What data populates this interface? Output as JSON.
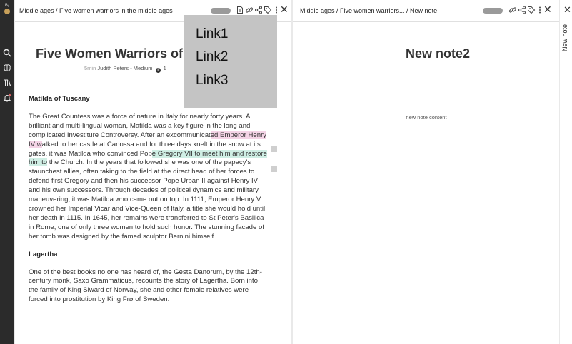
{
  "rail": {
    "brand_text": "B/",
    "icons": [
      "search-icon",
      "brain-icon",
      "library-icon",
      "bell-icon"
    ]
  },
  "pane_left": {
    "breadcrumb": "Middle ages / Five women warriors in the middle ages",
    "title": "Five Women Warriors of th",
    "meta": {
      "read_time": "5min",
      "author": "Judith Peters - Medium",
      "info_glyph": "i",
      "count": "1"
    },
    "sections": [
      {
        "heading": "Matilda of Tuscany",
        "paragraph": {
          "before_pink": "The Great Countess was a force of nature in Italy for nearly forty years. A brilliant and multi-lingual woman, Matilda was a key figure in the long and complicated Investiture Controversy. After an excommunicat",
          "pink": "ed Emperor Henry IV w",
          "between": "alked to her castle at Canossa and for three days knelt in the snow at its gates, it was Matilda who convinced Pop",
          "green": "e Gregory VII to meet him and restore him to",
          "after": " the Church. In the years that followed she was one of the papacy's staunchest allies, often taking to the field at the direct head of her forces to defend first Gregory and then his successor Pope Urban II against Henry IV and his own successors. Through decades of political dynamics and military maneuvering, it was Matilda who came out on top. In 1111, Emperor Henry V crowned her Imperial Vicar and Vice-Queen of Italy, a title she would hold until her death in 1115. In 1645, her remains were transferred to St Peter's Basilica in Rome, one of only three women to hold such honor. The stunning facade of her tomb was designed by the famed sculptor Bernini himself."
        }
      },
      {
        "heading": "Lagertha",
        "paragraph": "One of the best books no one has heard of, the Gesta Danorum, by the 12th-century monk, Saxo Grammaticus, recounts the story of Lagertha. Born into the family of King Siward of Norway, she and other female relatives were forced into prostitution by King Frø of Sweden."
      }
    ]
  },
  "pane_right": {
    "breadcrumb": "Middle ages / Five women warriors... / New note",
    "title": "New note2",
    "content": "new note content"
  },
  "side_tab": {
    "label": "New note",
    "close_glyph": "✕"
  },
  "popup": {
    "links": [
      "Link1",
      "Link2",
      "Link3"
    ]
  },
  "close_glyph": "✕",
  "colors": {
    "highlight_pink": "#f4d4e6",
    "highlight_green": "#cfeee4",
    "rail_bg": "#2b2b2b",
    "popup_bg": "#c4c4c4"
  }
}
